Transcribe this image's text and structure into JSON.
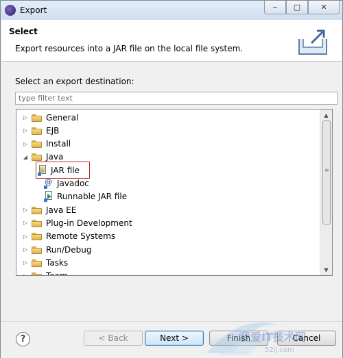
{
  "window": {
    "title": "Export"
  },
  "banner": {
    "title": "Select",
    "description": "Export resources into a JAR file on the local file system."
  },
  "destination": {
    "label": "Select an export destination:",
    "filter_placeholder": "type filter text"
  },
  "tree": {
    "items": [
      {
        "label": "General",
        "expanded": false,
        "type": "folder",
        "indent": 0
      },
      {
        "label": "EJB",
        "expanded": false,
        "type": "folder",
        "indent": 0
      },
      {
        "label": "Install",
        "expanded": false,
        "type": "folder",
        "indent": 0
      },
      {
        "label": "Java",
        "expanded": true,
        "type": "folder",
        "indent": 0
      },
      {
        "label": "JAR file",
        "type": "jar",
        "indent": 1,
        "selected": true
      },
      {
        "label": "Javadoc",
        "type": "javadoc",
        "indent": 1
      },
      {
        "label": "Runnable JAR file",
        "type": "runnable",
        "indent": 1
      },
      {
        "label": "Java EE",
        "expanded": false,
        "type": "folder",
        "indent": 0
      },
      {
        "label": "Plug-in Development",
        "expanded": false,
        "type": "folder",
        "indent": 0
      },
      {
        "label": "Remote Systems",
        "expanded": false,
        "type": "folder",
        "indent": 0
      },
      {
        "label": "Run/Debug",
        "expanded": false,
        "type": "folder",
        "indent": 0
      },
      {
        "label": "Tasks",
        "expanded": false,
        "type": "folder",
        "indent": 0
      },
      {
        "label": "Team",
        "expanded": false,
        "type": "folder",
        "indent": 0
      }
    ],
    "scroll_position": 0.0,
    "selection_color": "#b02a2a"
  },
  "footer": {
    "help_label": "?",
    "back_label": "< Back",
    "next_label": "Next >",
    "finish_label": "Finish",
    "cancel_label": "Cancel"
  },
  "watermark": {
    "text_line1": "我爱IT技术网",
    "text_line2": "52ij.com"
  },
  "icons": {
    "window_app": "eclipse-icon",
    "export": "export-box-icon"
  }
}
